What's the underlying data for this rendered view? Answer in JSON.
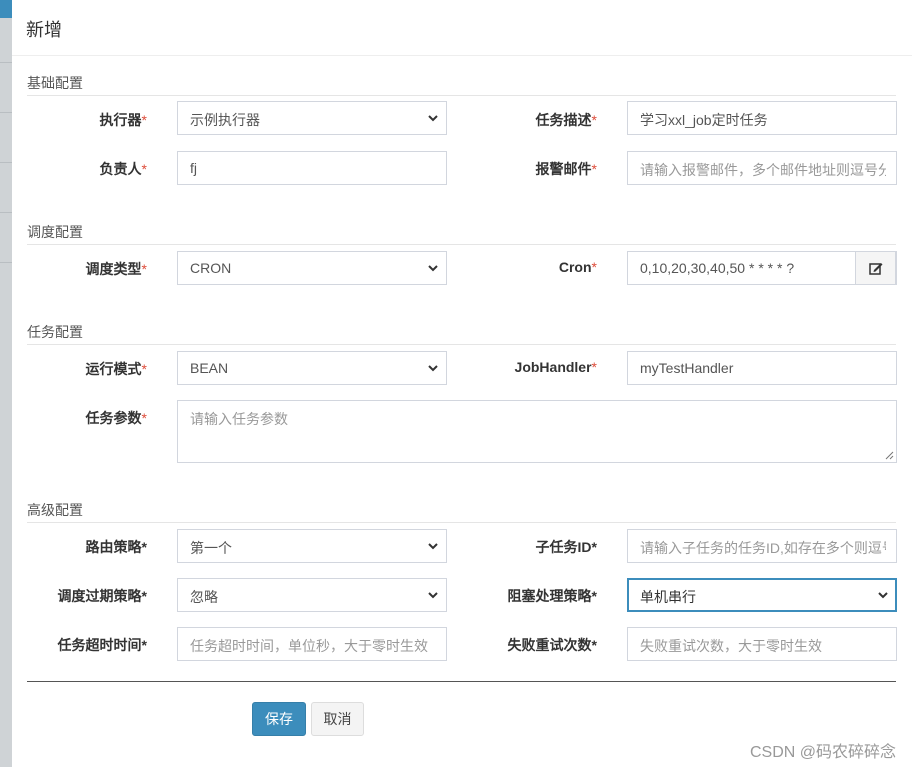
{
  "modal": {
    "title": "新增"
  },
  "sections": {
    "basic": "基础配置",
    "schedule": "调度配置",
    "task": "任务配置",
    "advanced": "高级配置"
  },
  "required_mark": "*",
  "fields": {
    "executor": {
      "label": "执行器",
      "value": "示例执行器"
    },
    "job_desc": {
      "label": "任务描述",
      "value": "学习xxl_job定时任务"
    },
    "author": {
      "label": "负责人",
      "value": "fj"
    },
    "alarm_email": {
      "label": "报警邮件",
      "placeholder": "请输入报警邮件，多个邮件地址则逗号分"
    },
    "schedule_type": {
      "label": "调度类型",
      "value": "CRON"
    },
    "cron": {
      "label": "Cron",
      "value": "0,10,20,30,40,50 * * * * ?"
    },
    "glue_type": {
      "label": "运行模式",
      "value": "BEAN"
    },
    "job_handler": {
      "label": "JobHandler",
      "value": "myTestHandler"
    },
    "job_param": {
      "label": "任务参数",
      "placeholder": "请输入任务参数"
    },
    "route_strategy": {
      "label": "路由策略",
      "value": "第一个"
    },
    "child_job_id": {
      "label": "子任务ID",
      "placeholder": "请输入子任务的任务ID,如存在多个则逗号"
    },
    "misfire_strategy": {
      "label": "调度过期策略",
      "value": "忽略"
    },
    "block_strategy": {
      "label": "阻塞处理策略",
      "value": "单机串行"
    },
    "timeout": {
      "label": "任务超时时间",
      "placeholder": "任务超时时间，单位秒，大于零时生效"
    },
    "fail_retry": {
      "label": "失败重试次数",
      "placeholder": "失败重试次数，大于零时生效"
    }
  },
  "buttons": {
    "save": "保存",
    "cancel": "取消"
  },
  "watermark": "CSDN @码农碎碎念",
  "icons": {
    "select_arrow": "chevron-down-icon",
    "cron_edit": "edit-icon",
    "resize": "resize-grip-icon"
  },
  "colors": {
    "primary": "#3c8dbc",
    "required": "#dd4b39",
    "border": "#d2d6de"
  }
}
